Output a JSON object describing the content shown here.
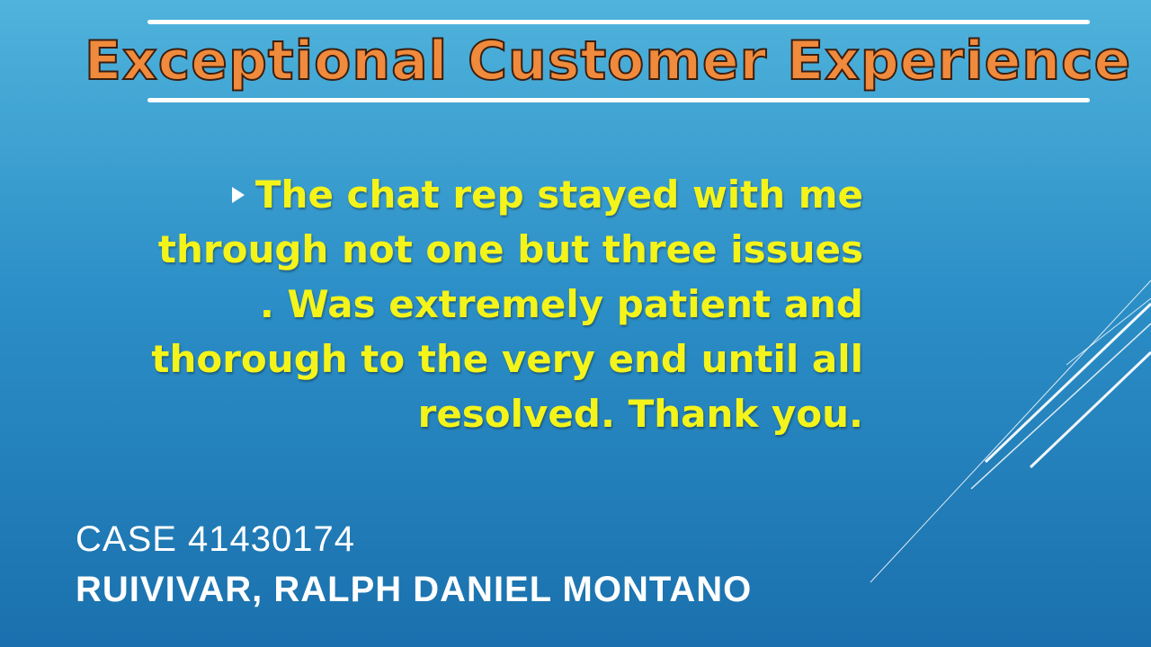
{
  "slide": {
    "title": "Exceptional Customer Experience",
    "quote": "The chat rep stayed with me through not one but three issues . Was extremely patient and thorough to the very end until all resolved. Thank you.",
    "quote_lines": [
      "The chat rep stayed with me",
      "through not one but three issues",
      ". Was extremely patient and",
      "thorough to the very end until all",
      "resolved. Thank you."
    ],
    "case_number": "CASE 41430174",
    "author": "RUIVIVAR, RALPH DANIEL MONTANO"
  },
  "colors": {
    "title_fill": "#f08a3c",
    "quote_text": "#f4f41a",
    "footer_text": "#ffffff"
  },
  "icons": {
    "bullet": "triangle-right-icon"
  }
}
